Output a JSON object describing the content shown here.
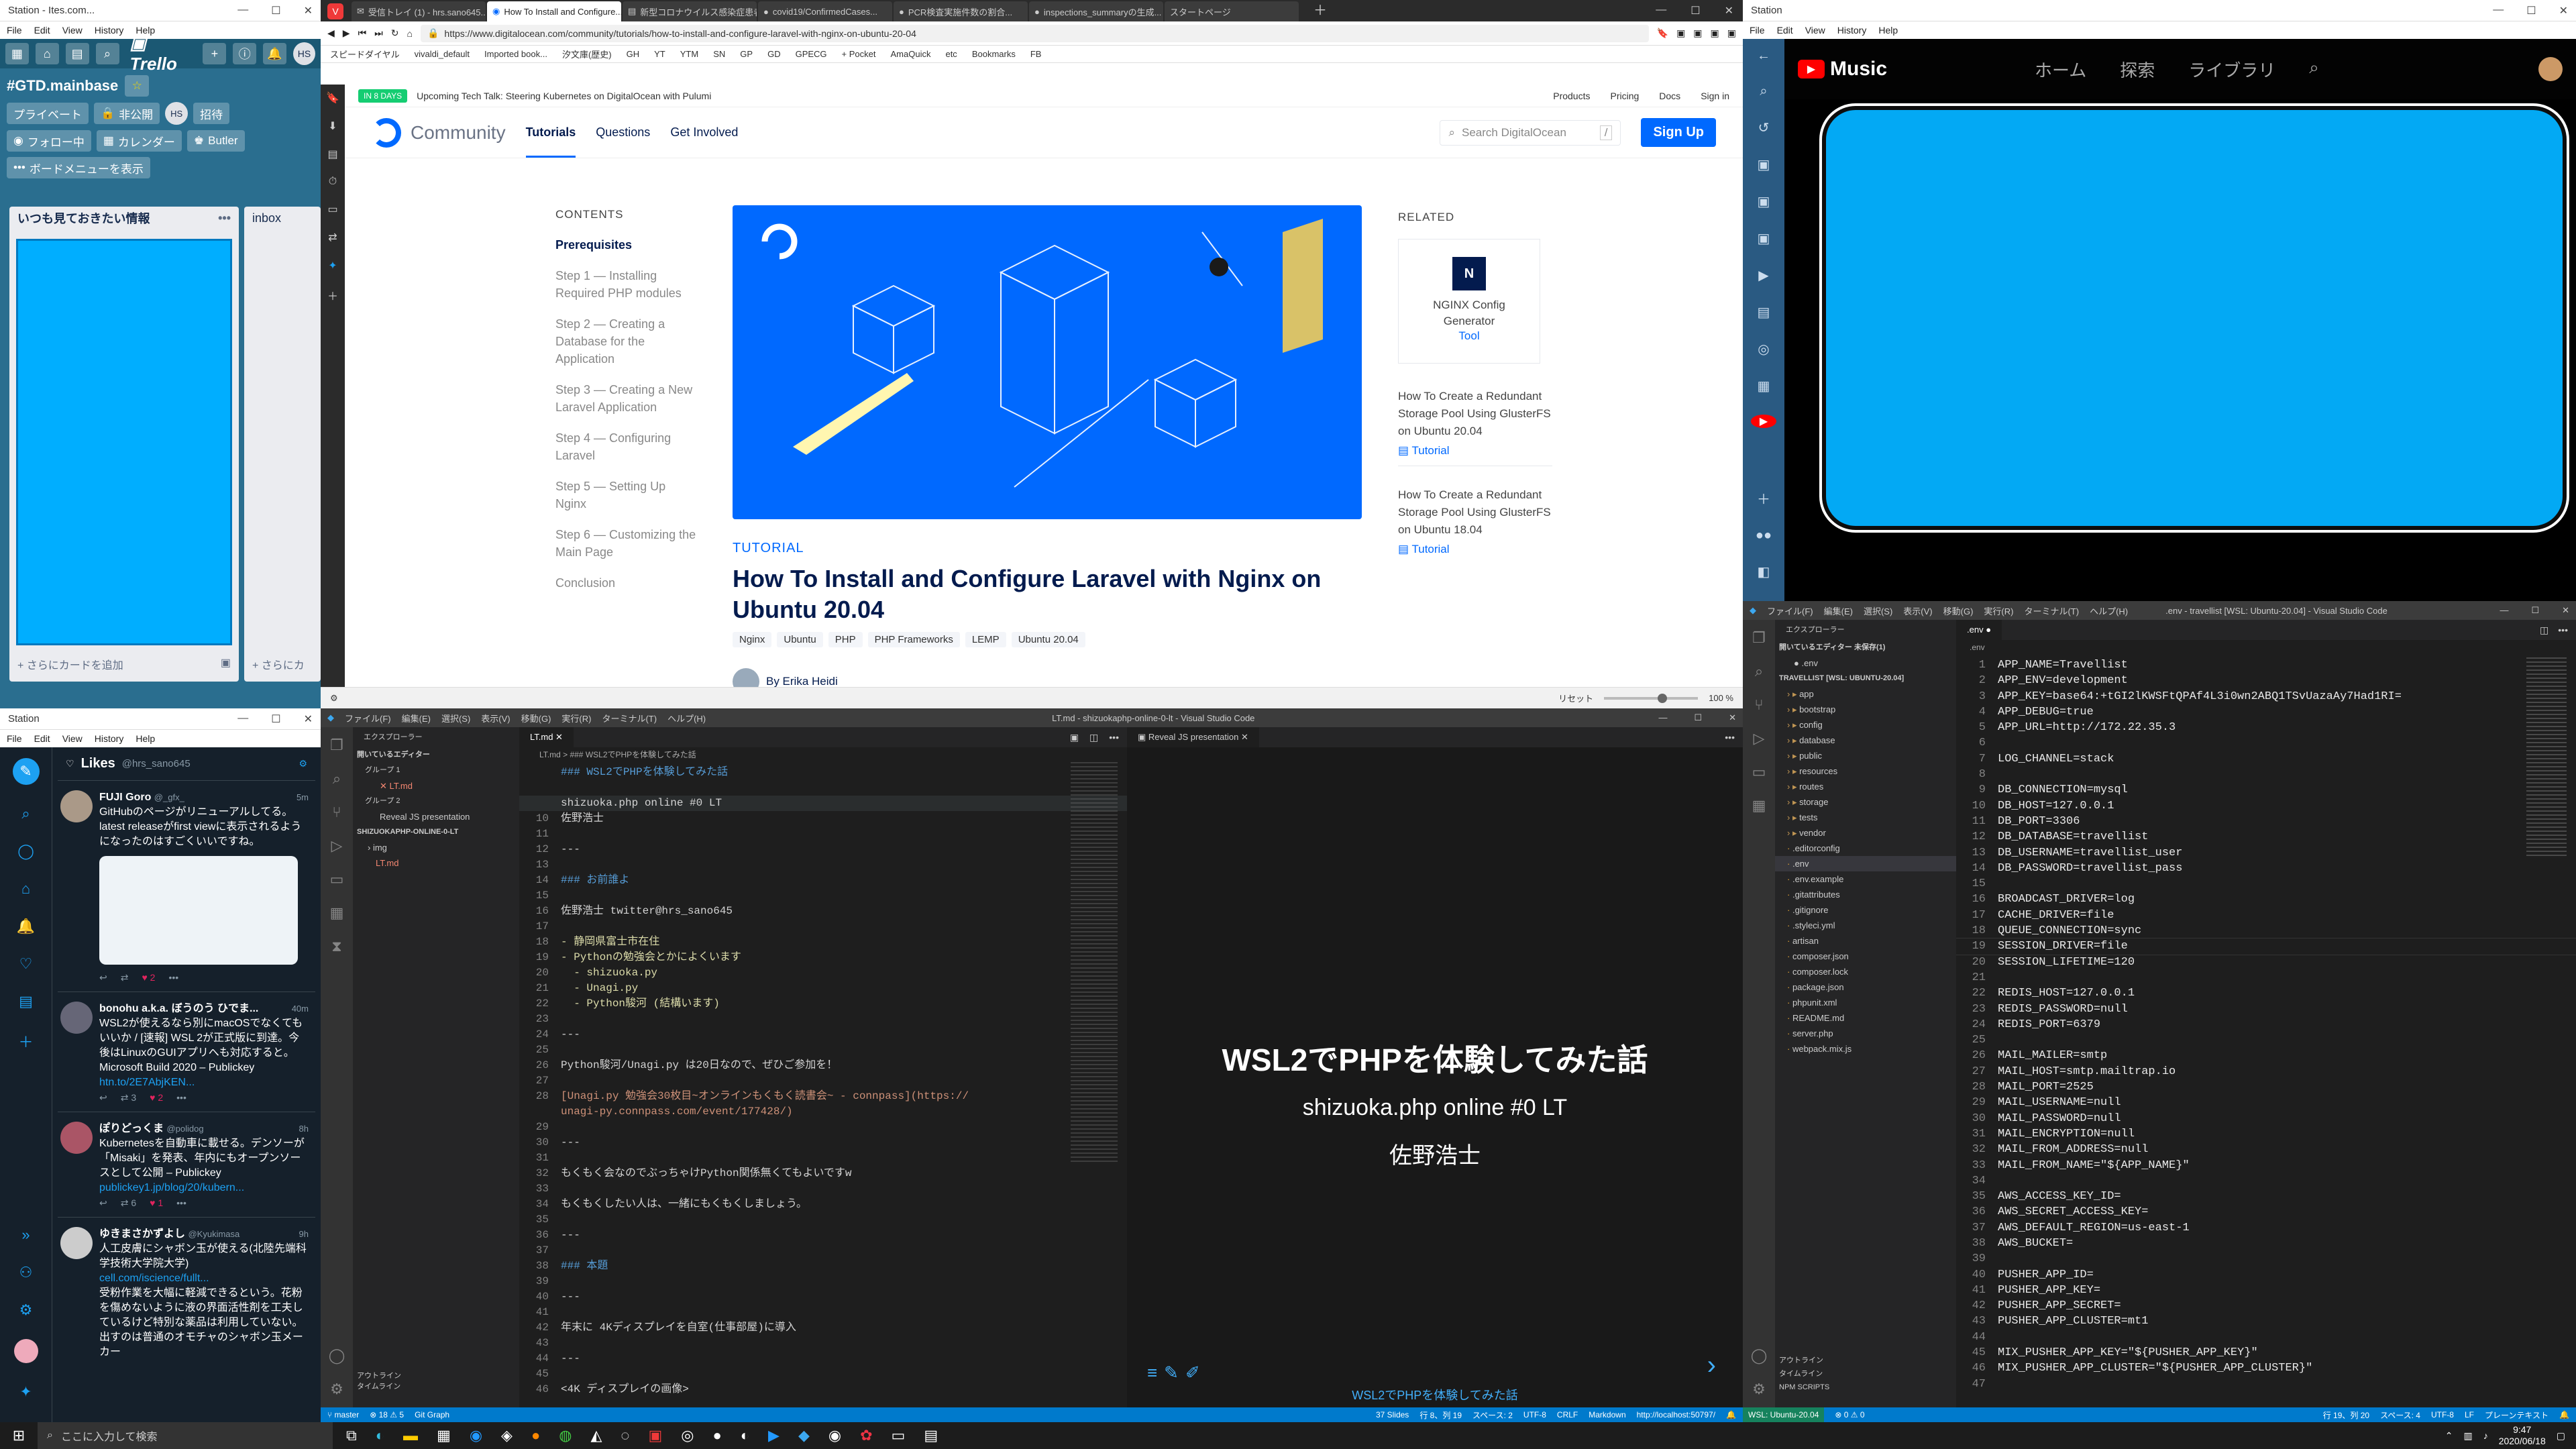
{
  "trello": {
    "title": "Station - Ites.com...",
    "menu": [
      "File",
      "Edit",
      "View",
      "History",
      "Help"
    ],
    "board_name": "#GTD.mainbase",
    "visibility": "プライベート",
    "private_btn": "非公開",
    "invite": "招待",
    "avatar": "HS",
    "follow": "フォロー中",
    "calendar": "カレンダー",
    "butler": "Butler",
    "board_menu": "ボードメニューを表示",
    "lists": [
      {
        "title": "いつも見ておきたい情報",
        "add": "+ さらにカードを追加"
      },
      {
        "title": "inbox",
        "add": "+ さらにカ"
      }
    ]
  },
  "browser": {
    "tabs": [
      "受信トレイ (1) - hrs.sano645...",
      "How To Install and Configure...",
      "新型コロナウイルス感染症患者...",
      "covid19/ConfirmedCases...",
      "PCR検査実施件数の割合...",
      "inspections_summaryの生成...",
      "スタートページ"
    ],
    "url": "https://www.digitalocean.com/community/tutorials/how-to-install-and-configure-laravel-with-nginx-on-ubuntu-20-04",
    "bookmarks": [
      "スピードダイヤル",
      "vivaldi_default",
      "Imported book...",
      "汐文庫(歴史)",
      "GH",
      "YT",
      "YTM",
      "SN",
      "GP",
      "GD",
      "GPECG",
      "+ Pocket",
      "AmaQuick",
      "etc",
      "Bookmarks",
      "FB"
    ],
    "zoom": "100 %",
    "reset": "リセット"
  },
  "digitalocean": {
    "badge": "IN 8 DAYS",
    "announcement": "Upcoming Tech Talk: Steering Kubernetes on DigitalOcean with Pulumi",
    "top_links": [
      "Products",
      "Pricing",
      "Docs",
      "Sign in"
    ],
    "brand": "Community",
    "nav": [
      "Tutorials",
      "Questions",
      "Get Involved"
    ],
    "search_placeholder": "Search DigitalOcean",
    "signup": "Sign Up",
    "contents_title": "CONTENTS",
    "toc": [
      "Prerequisites",
      "Step 1 — Installing Required PHP modules",
      "Step 2 — Creating a Database for the Application",
      "Step 3 — Creating a New Laravel Application",
      "Step 4 — Configuring Laravel",
      "Step 5 — Setting Up Nginx",
      "Step 6 — Customizing the Main Page",
      "Conclusion"
    ],
    "kicker": "TUTORIAL",
    "title": "How To Install and Configure Laravel with Nginx on Ubuntu 20.04",
    "tags": [
      "Nginx",
      "Ubuntu",
      "PHP",
      "PHP Frameworks",
      "LEMP",
      "Ubuntu 20.04"
    ],
    "author": "By Erika Heidi",
    "related_title": "RELATED",
    "tool_card": {
      "title": "NGINX Config Generator",
      "type": "Tool"
    },
    "related": [
      {
        "title": "How To Create a Redundant Storage Pool Using GlusterFS on Ubuntu 20.04",
        "type": "Tutorial"
      },
      {
        "title": "How To Create a Redundant Storage Pool Using GlusterFS on Ubuntu 18.04",
        "type": "Tutorial"
      }
    ]
  },
  "music": {
    "title": "Station",
    "menu": [
      "File",
      "Edit",
      "View",
      "History",
      "Help"
    ],
    "brand": "Music",
    "nav": [
      "ホーム",
      "探索",
      "ライブラリ"
    ]
  },
  "twitter": {
    "title": "Station",
    "menu": [
      "File",
      "Edit",
      "View",
      "History",
      "Help"
    ],
    "header": "Likes",
    "handle": "@hrs_sano645",
    "tweets": [
      {
        "name": "FUJI Goro",
        "handle": "@_gfx_",
        "time": "5m",
        "text": "GitHubのページがリニューアルしてる。latest releaseがfirst viewに表示されるようになったのはすごくいいですね。",
        "stats": [
          "",
          "",
          "2"
        ]
      },
      {
        "name": "bonohu a.k.a. ぼうのう ひでま...",
        "handle": "",
        "time": "40m",
        "text": "WSL2が使えるなら別にmacOSでなくてもいいか / [速報] WSL 2が正式版に到達。今後はLinuxのGUIアプリへも対応すると。Microsoft Build 2020 – Publickey",
        "link": "htn.to/2E7AbjKEN...",
        "stats": [
          "",
          "3",
          "2"
        ]
      },
      {
        "name": "ぽりどっくま",
        "handle": "@polidog",
        "time": "8h",
        "text": "Kubernetesを自動車に載せる。デンソーが「Misaki」を発表、年内にもオープンソースとして公開 – Publickey",
        "link": "publickey1.jp/blog/20/kubern...",
        "stats": [
          "",
          "6",
          "1"
        ]
      },
      {
        "name": "ゆきまさかずよし",
        "handle": "@Kyukimasa",
        "time": "9h",
        "text": "人工皮膚にシャボン玉が使える(北陸先端科学技術大学院大学)",
        "link": "cell.com/iscience/fullt...",
        "text2": "受粉作業を大幅に軽減できるという。花粉を傷めないように液の界面活性剤を工夫しているけど特別な薬品は利用していない。出すのは普通のオモチャのシャボン玉メーカー"
      }
    ]
  },
  "vscode_left": {
    "title": "LT.md - shizuokaphp-online-0-lt - Visual Studio Code",
    "menu": [
      "ファイル(F)",
      "編集(E)",
      "選択(S)",
      "表示(V)",
      "移動(G)",
      "実行(R)",
      "ターミナル(T)",
      "ヘルプ(H)"
    ],
    "explorer": "エクスプローラー",
    "open_editors": "開いているエディター",
    "group1": "グループ 1",
    "group1_file": "LT.md",
    "group2": "グループ 2",
    "group2_file": "Reveal JS presentation",
    "folder": "SHIZUOKAPHP-ONLINE-0-LT",
    "folder_items": [
      "img",
      "LT.md"
    ],
    "outline": [
      "アウトライン",
      "タイムライン"
    ],
    "tab": "LT.md",
    "breadcrumb": "LT.md > ### WSL2でPHPを体験してみた話",
    "code": [
      {
        "n": "",
        "t": "### WSL2でPHPを体験してみた話",
        "c": "#569cd6"
      },
      {
        "n": "",
        "t": "",
        "c": "#d4d4d4"
      },
      {
        "n": "",
        "t": "shizuoka.php online #0 LT",
        "c": "#d4d4d4"
      },
      {
        "n": "10",
        "t": "佐野浩士",
        "c": "#d4d4d4"
      },
      {
        "n": "11",
        "t": "",
        "c": "#d4d4d4"
      },
      {
        "n": "12",
        "t": "---",
        "c": "#d4d4d4"
      },
      {
        "n": "13",
        "t": "",
        "c": "#d4d4d4"
      },
      {
        "n": "14",
        "t": "### お前誰よ",
        "c": "#569cd6"
      },
      {
        "n": "15",
        "t": "",
        "c": "#d4d4d4"
      },
      {
        "n": "16",
        "t": "佐野浩士 twitter@hrs_sano645",
        "c": "#d4d4d4"
      },
      {
        "n": "17",
        "t": "",
        "c": "#d4d4d4"
      },
      {
        "n": "18",
        "t": "- 静岡県富士市在住",
        "c": "#dcdcaa"
      },
      {
        "n": "19",
        "t": "- Pythonの勉強会とかによくいます",
        "c": "#dcdcaa"
      },
      {
        "n": "20",
        "t": "  - shizuoka.py",
        "c": "#dcdcaa"
      },
      {
        "n": "21",
        "t": "  - Unagi.py",
        "c": "#dcdcaa"
      },
      {
        "n": "22",
        "t": "  - Python駿河 (結構います)",
        "c": "#dcdcaa"
      },
      {
        "n": "23",
        "t": "",
        "c": "#d4d4d4"
      },
      {
        "n": "24",
        "t": "---",
        "c": "#d4d4d4"
      },
      {
        "n": "25",
        "t": "",
        "c": "#d4d4d4"
      },
      {
        "n": "26",
        "t": "Python駿河/Unagi.py は20日なので、ぜひご参加を！",
        "c": "#d4d4d4"
      },
      {
        "n": "27",
        "t": "",
        "c": "#d4d4d4"
      },
      {
        "n": "28",
        "t": "[Unagi.py 勉強会30枚目~オンラインもくもく読書会~ - connpass](https://",
        "c": "#ce9178"
      },
      {
        "n": "",
        "t": "unagi-py.connpass.com/event/177428/)",
        "c": "#ce9178"
      },
      {
        "n": "29",
        "t": "",
        "c": "#d4d4d4"
      },
      {
        "n": "30",
        "t": "---",
        "c": "#d4d4d4"
      },
      {
        "n": "31",
        "t": "",
        "c": "#d4d4d4"
      },
      {
        "n": "32",
        "t": "もくもく会なのでぶっちゃけPython関係無くてもよいですw",
        "c": "#d4d4d4"
      },
      {
        "n": "33",
        "t": "",
        "c": "#d4d4d4"
      },
      {
        "n": "34",
        "t": "もくもくしたい人は、一緒にもくもくしましょう。",
        "c": "#d4d4d4"
      },
      {
        "n": "35",
        "t": "",
        "c": "#d4d4d4"
      },
      {
        "n": "36",
        "t": "---",
        "c": "#d4d4d4"
      },
      {
        "n": "37",
        "t": "",
        "c": "#d4d4d4"
      },
      {
        "n": "38",
        "t": "### 本題",
        "c": "#569cd6"
      },
      {
        "n": "39",
        "t": "",
        "c": "#d4d4d4"
      },
      {
        "n": "40",
        "t": "---",
        "c": "#d4d4d4"
      },
      {
        "n": "41",
        "t": "",
        "c": "#d4d4d4"
      },
      {
        "n": "42",
        "t": "年末に 4Kディスプレイを自室(仕事部屋)に導入",
        "c": "#d4d4d4"
      },
      {
        "n": "43",
        "t": "",
        "c": "#d4d4d4"
      },
      {
        "n": "44",
        "t": "---",
        "c": "#d4d4d4"
      },
      {
        "n": "45",
        "t": "",
        "c": "#d4d4d4"
      },
      {
        "n": "46",
        "t": "<4K ディスプレイの画像>",
        "c": "#d4d4d4"
      }
    ],
    "preview_tab": "Reveal JS presentation",
    "slide": {
      "title": "WSL2でPHPを体験してみた話",
      "subtitle": "shizuoka.php online #0 LT",
      "author": "佐野浩士",
      "footer": "WSL2でPHPを体験してみた話"
    },
    "status": [
      "master",
      "⊗ 18 ⚠ 5",
      "Git Graph",
      "37 Slides",
      "行 8、列 19",
      "スペース: 2",
      "UTF-8",
      "CRLF",
      "Markdown",
      "http://localhost:50797/"
    ]
  },
  "vscode_right": {
    "title": ".env - travellist [WSL: Ubuntu-20.04] - Visual Studio Code",
    "menu": [
      "ファイル(F)",
      "編集(E)",
      "選択(S)",
      "表示(V)",
      "移動(G)",
      "実行(R)",
      "ターミナル(T)",
      "ヘルプ(H)"
    ],
    "explorer": "エクスプローラー",
    "open_editors": "開いているエディター 未保存(1)",
    "open_file": ".env",
    "folder": "TRAVELLIST [WSL: UBUNTU-20.04]",
    "files": [
      "app",
      "bootstrap",
      "config",
      "database",
      "public",
      "resources",
      "routes",
      "storage",
      "tests",
      "vendor",
      ".editorconfig",
      ".env",
      ".env.example",
      ".gitattributes",
      ".gitignore",
      ".styleci.yml",
      "artisan",
      "composer.json",
      "composer.lock",
      "package.json",
      "phpunit.xml",
      "README.md",
      "server.php",
      "webpack.mix.js"
    ],
    "outline": [
      "アウトライン",
      "タイムライン",
      "NPM SCRIPTS"
    ],
    "tab": ".env",
    "lines": [
      "APP_NAME=Travellist",
      "APP_ENV=development",
      "APP_KEY=base64:+tGI2lKWSFtQPAf4L3i0wn2ABQ1TSvUazaAy7Had1RI=",
      "APP_DEBUG=true",
      "APP_URL=http://172.22.35.3",
      "",
      "LOG_CHANNEL=stack",
      "",
      "DB_CONNECTION=mysql",
      "DB_HOST=127.0.0.1",
      "DB_PORT=3306",
      "DB_DATABASE=travellist",
      "DB_USERNAME=travellist_user",
      "DB_PASSWORD=travellist_pass",
      "",
      "BROADCAST_DRIVER=log",
      "CACHE_DRIVER=file",
      "QUEUE_CONNECTION=sync",
      "SESSION_DRIVER=file",
      "SESSION_LIFETIME=120",
      "",
      "REDIS_HOST=127.0.0.1",
      "REDIS_PASSWORD=null",
      "REDIS_PORT=6379",
      "",
      "MAIL_MAILER=smtp",
      "MAIL_HOST=smtp.mailtrap.io",
      "MAIL_PORT=2525",
      "MAIL_USERNAME=null",
      "MAIL_PASSWORD=null",
      "MAIL_ENCRYPTION=null",
      "MAIL_FROM_ADDRESS=null",
      "MAIL_FROM_NAME=\"${APP_NAME}\"",
      "",
      "AWS_ACCESS_KEY_ID=",
      "AWS_SECRET_ACCESS_KEY=",
      "AWS_DEFAULT_REGION=us-east-1",
      "AWS_BUCKET=",
      "",
      "PUSHER_APP_ID=",
      "PUSHER_APP_KEY=",
      "PUSHER_APP_SECRET=",
      "PUSHER_APP_CLUSTER=mt1",
      "",
      "MIX_PUSHER_APP_KEY=\"${PUSHER_APP_KEY}\"",
      "MIX_PUSHER_APP_CLUSTER=\"${PUSHER_APP_CLUSTER}\"",
      ""
    ],
    "status": [
      "WSL: Ubuntu-20.04",
      "⊗ 0 ⚠ 0",
      "行 19、列 20",
      "スペース: 4",
      "UTF-8",
      "LF",
      "プレーンテキスト"
    ]
  },
  "taskbar": {
    "search_placeholder": "ここに入力して検索",
    "time": "9:47",
    "date": "2020/06/18"
  },
  "colors": {
    "accent": "#0069ff",
    "vscode_status": "#007acc",
    "trello_blue": "#00aeff",
    "music_blue": "#03a9f4",
    "twitter_bg": "#15202b"
  }
}
